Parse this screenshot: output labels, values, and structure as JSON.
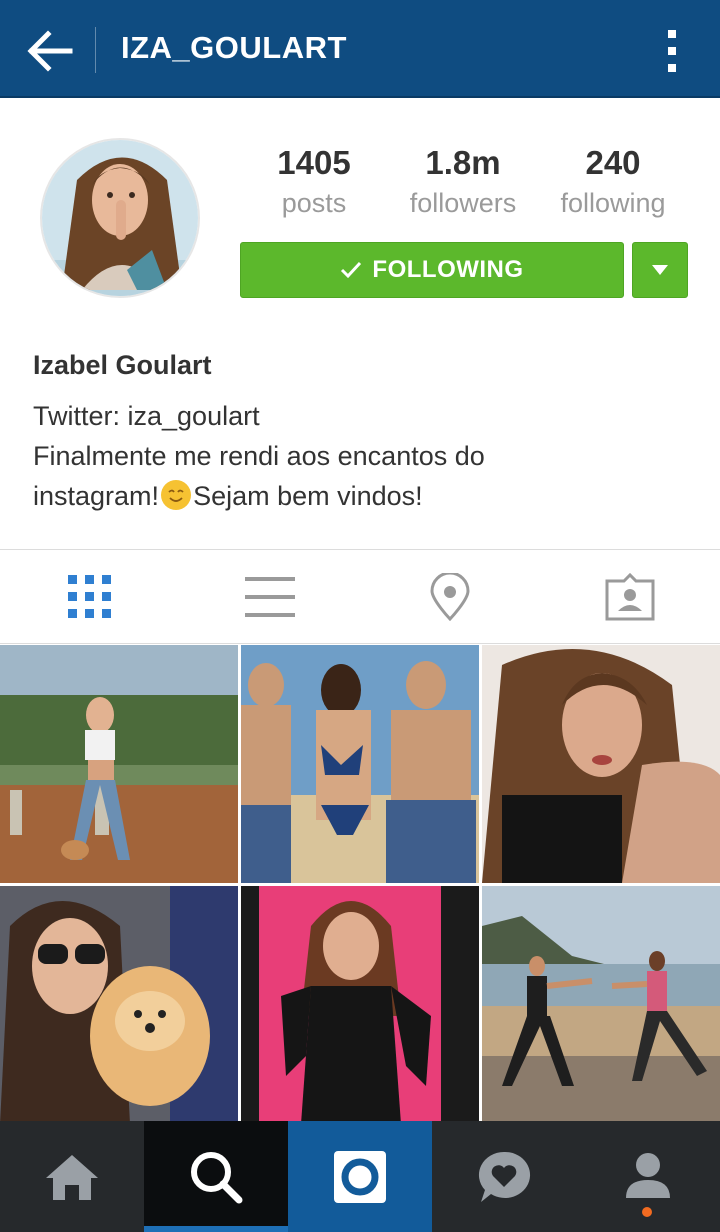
{
  "header": {
    "username": "IZA_GOULART",
    "back_icon": "arrow-left-icon",
    "more_icon": "vertical-dots-icon"
  },
  "profile": {
    "stats": {
      "posts_value": "1405",
      "posts_label": "posts",
      "followers_value": "1.8m",
      "followers_label": "followers",
      "following_value": "240",
      "following_label": "following"
    },
    "follow_button_label": "FOLLOWING",
    "full_name": "Izabel Goulart",
    "bio_line1": "Twitter: iza_goulart",
    "bio_line2": "Finalmente me rendi aos encantos do",
    "bio_line3a": "instagram!",
    "bio_line3b": "Sejam bem vindos!"
  },
  "view_tabs": [
    "grid-icon",
    "list-icon",
    "location-pin-icon",
    "tagged-person-icon"
  ],
  "bottom_nav": [
    "home-icon",
    "search-icon",
    "camera-icon",
    "activity-heart-icon",
    "profile-icon"
  ],
  "colors": {
    "header_bg": "#0f4c81",
    "follow_green": "#5cb82c",
    "active_blue": "#1e6fb6",
    "nav_bg": "#26292c",
    "notification_dot": "#f26b21"
  }
}
